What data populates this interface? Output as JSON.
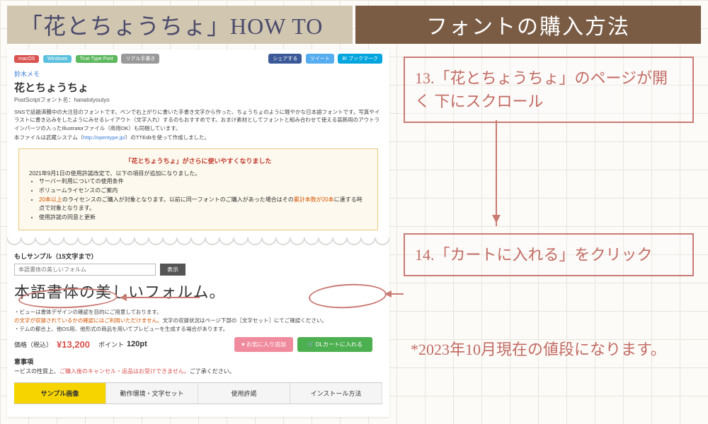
{
  "banner": {
    "left": "「花とちょうちょ」HOW TO",
    "right": "フォントの購入方法"
  },
  "pills": {
    "p1": "macOS",
    "p2": "Windows",
    "p3": "True Type Font",
    "p4": "リアル手書き"
  },
  "share": {
    "fb": "シェアする",
    "tw": "ツイート",
    "bm": "B! ブックマーク"
  },
  "memo": "鈴木メモ",
  "font_title": "花とちょうちょ",
  "font_sub": "PostScriptフォント名：hanatotyoutyo",
  "desc1": "SNSで話題沸騰中の大注目のフォントです。ペンで右上がりに書いた手書き文字から作った、ちょうちょのように軽やかな日本語フォントです。写真やイラストに書き込みをしたようにみせるレイアウト（文字入れ）するのもおすすめです。おまけ素材としてフォントと組み合わせて使える装飾用のアウトラインパーツの入ったIllustratorファイル（商用OK）も同梱しています。",
  "desc2_a": "本ファイルは武蔵システム（",
  "desc2_link": "http://opentype.jp/",
  "desc2_b": "）のTTEditを使って作成しました。",
  "notice": {
    "title": "「花とちょうちょ」がさらに使いやすくなりました",
    "lead": "2021年9月1日の使用許諾改定で、以下の項目が追加になりました。",
    "i1": "サーバー利用についての使用条件",
    "i2": "ボリュームライセンスのご案内",
    "i3a": "20本以上",
    "i3b": "のライセンスのご購入が対象となります。以前に同一フォントのご購入があった場合はその",
    "i3c": "累計本数が20本",
    "i3d": "に達する時点で対象となります。",
    "i4": "使用許諾の同意と更新"
  },
  "sample": {
    "label": "もしサンプル（15文字まで）",
    "placeholder": "本語書体の美しいフォルム",
    "btn": "表示"
  },
  "script_text": "本語書体の美しいフォルム。",
  "hints": {
    "h1": "・ビューは書体デザインの確認を目的にご用意しております。",
    "h2a": "の文字が収録されているかの確認にはご利用いただけません。",
    "h2b": "文字の収録状況はページ下部の［文字セット］にてご確認ください。",
    "h3": "・テムの都合上、他OS用、他形式の商品を用いてプレビューを生成する場合があります。"
  },
  "price": {
    "label": "価格（税込）",
    "value": "¥13,200",
    "pt_label": "ポイント",
    "pt_value": "120pt"
  },
  "fav_btn": "♥ お気に入り追加",
  "cart_btn": "🛒 DLカートに入れる",
  "caution": {
    "label": "意事項",
    "a": "ービスの性質上、",
    "b": "ご購入後のキャンセル・返品はお受けできません。",
    "c": "ご了承ください。"
  },
  "tabs": {
    "t1": "サンプル画像",
    "t2": "動作環境・文字セット",
    "t3": "使用許諾",
    "t4": "インストール方法"
  },
  "ann": {
    "s13": "13.「花とちょうちょ」のページが開く 下にスクロール",
    "s14": "14.「カートに入れる」をクリック",
    "note": "*2023年10月現在の値段になります。"
  }
}
